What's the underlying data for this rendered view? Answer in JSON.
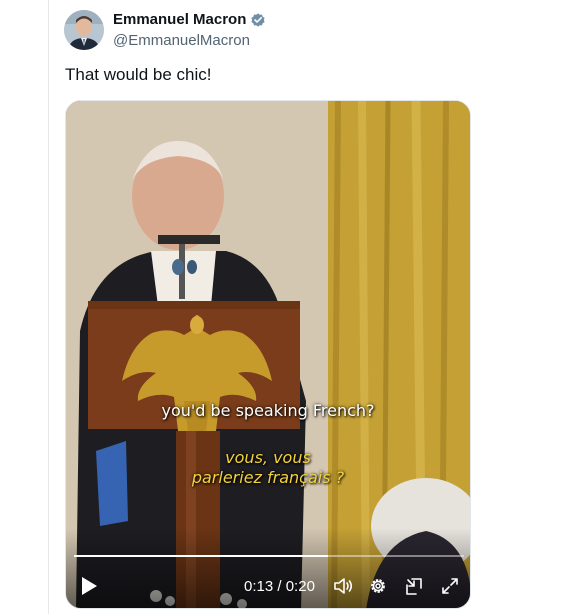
{
  "author": {
    "name": "Emmanuel Macron",
    "handle": "@EmmanuelMacron",
    "verified_badge_color": "#6f8fa8"
  },
  "tweet": {
    "text": "That would be chic!"
  },
  "video": {
    "subtitle_english": "you'd be speaking French?",
    "subtitle_french_line1": "vous, vous",
    "subtitle_french_line2": "parleriez français ?",
    "subtitle_french_color": "#f3d23b",
    "current_time": "0:13",
    "time_separator": " / ",
    "duration": "0:20",
    "progress_fraction": 0.65,
    "controls": {
      "play": "play-icon",
      "volume": "volume-icon",
      "settings": "gear-icon",
      "pip": "picture-in-picture-icon",
      "fullscreen": "fullscreen-icon"
    }
  }
}
